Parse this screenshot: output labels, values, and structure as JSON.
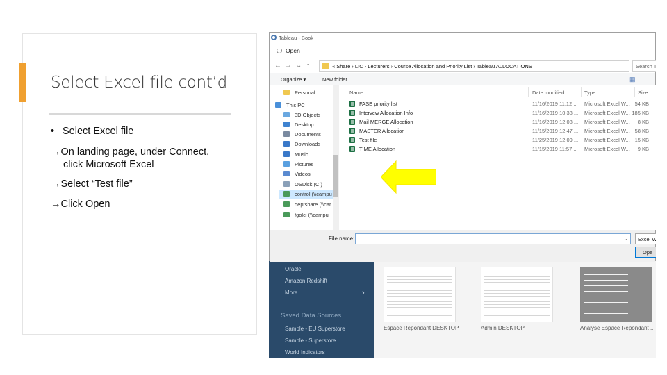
{
  "slide": {
    "title": "Select Excel file cont’d",
    "bullet": "Select Excel file",
    "bullet_marker": "•",
    "steps": [
      "On landing page, under Connect,",
      "click Microsoft Excel",
      "Select “Test file”",
      "Click Open"
    ],
    "arrow": "→"
  },
  "window": {
    "app_title": "Tableau - Book",
    "dialog_title": "Open"
  },
  "nav": {
    "back": "←",
    "forward": "→",
    "recent": "⌄",
    "up": "↑",
    "path": "« Share  ›  LIC  ›  Lecturers  ›  Course Allocation and Priority List  ›  Tableau ALLOCATIONS",
    "search_placeholder": "Search Ta"
  },
  "toolbar": {
    "organize": "Organize ▾",
    "new_folder": "New folder"
  },
  "sidebar": {
    "items": [
      {
        "label": "Personal",
        "icon": "folder-icon",
        "color": "#f0c850"
      },
      {
        "label": "This PC",
        "icon": "computer-icon",
        "color": "#4a90d9"
      },
      {
        "label": "3D Objects",
        "icon": "cube-icon",
        "color": "#6aa8e0"
      },
      {
        "label": "Desktop",
        "icon": "desktop-icon",
        "color": "#3f83d0"
      },
      {
        "label": "Documents",
        "icon": "documents-icon",
        "color": "#7a8aa0"
      },
      {
        "label": "Downloads",
        "icon": "download-icon",
        "color": "#3a78c8"
      },
      {
        "label": "Music",
        "icon": "music-icon",
        "color": "#3a78c8"
      },
      {
        "label": "Pictures",
        "icon": "pictures-icon",
        "color": "#5aa0e0"
      },
      {
        "label": "Videos",
        "icon": "videos-icon",
        "color": "#5a8ad0"
      },
      {
        "label": "OSDisk (C:)",
        "icon": "drive-icon",
        "color": "#8aa0b8"
      },
      {
        "label": "control (\\\\campu",
        "icon": "network-drive-icon",
        "color": "#4a9a5a"
      },
      {
        "label": "deptshare (\\\\car",
        "icon": "network-drive-icon",
        "color": "#4a9a5a"
      },
      {
        "label": "fgolci (\\\\campu",
        "icon": "network-drive-icon",
        "color": "#4a9a5a"
      }
    ]
  },
  "columns": {
    "name": "Name",
    "date": "Date modified",
    "type": "Type",
    "size": "Size"
  },
  "files": [
    {
      "name": "FASE priority list",
      "date": "11/16/2019 11:12 ...",
      "type": "Microsoft Excel W...",
      "size": "54 KB"
    },
    {
      "name": "Intervew Allocation Info",
      "date": "11/16/2019 10:38 ...",
      "type": "Microsoft Excel W...",
      "size": "185 KB"
    },
    {
      "name": "Mail MERGE Allocation",
      "date": "11/16/2019 12:08 ...",
      "type": "Microsoft Excel W...",
      "size": "8 KB"
    },
    {
      "name": "MASTER Allocation",
      "date": "11/15/2019 12:47 ...",
      "type": "Microsoft Excel W...",
      "size": "58 KB"
    },
    {
      "name": "Test file",
      "date": "11/25/2019 12:09 ...",
      "type": "Microsoft Excel W...",
      "size": "15 KB"
    },
    {
      "name": "TIME Allocation",
      "date": "11/15/2019 11:57 ...",
      "type": "Microsoft Excel W...",
      "size": "9 KB"
    }
  ],
  "bottom": {
    "filename_label": "File name:",
    "filename_value": "",
    "filetype": "Excel Wo",
    "open": "Ope"
  },
  "tableau": {
    "connect_items": [
      "Oracle",
      "Amazon Redshift",
      "More"
    ],
    "saved_header": "Saved Data Sources",
    "saved_items": [
      "Sample - EU Superstore",
      "Sample - Superstore",
      "World Indicators"
    ],
    "thumbnails": [
      "Espace Repondant DESKTOP",
      "Admin DESKTOP",
      "Analyse Espace Repondant ..."
    ]
  },
  "colors": {
    "accent": "#f0a030",
    "arrow_highlight": "#ffff00",
    "tableau_sidebar": "#2a4a6a"
  }
}
